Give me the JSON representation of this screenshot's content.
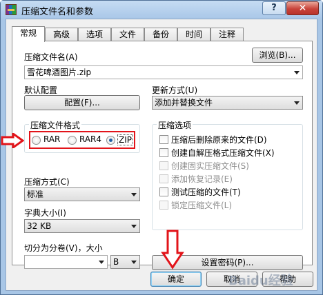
{
  "window": {
    "title": "压缩文件名和参数",
    "help_label": "?",
    "close_label": "✕"
  },
  "tabs": [
    {
      "label": "常规"
    },
    {
      "label": "高级"
    },
    {
      "label": "选项"
    },
    {
      "label": "文件"
    },
    {
      "label": "备份"
    },
    {
      "label": "时间"
    },
    {
      "label": "注释"
    }
  ],
  "general": {
    "archive_name_label": "压缩文件名(A)",
    "browse_label": "浏览(B)...",
    "archive_name_value": "雪花啤酒图片.zip",
    "default_profile_label": "默认配置",
    "profiles_label": "配置(F)...",
    "update_mode_label": "更新方式(U)",
    "update_mode_value": "添加并替换文件",
    "format_group_title": "压缩文件格式",
    "format_rar": "RAR",
    "format_rar4": "RAR4",
    "format_zip": "ZIP",
    "compression_method_label": "压缩方式(C)",
    "compression_method_value": "标准",
    "dictionary_size_label": "字典大小(I)",
    "dictionary_size_value": "32 KB",
    "split_label": "切分为分卷(V)，大小",
    "split_unit_value": "B",
    "set_password_label": "设置密码(P)...",
    "options_group_title": "压缩选项",
    "options": [
      {
        "label": "压缩后删除原来的文件(D)",
        "enabled": true
      },
      {
        "label": "创建自解压格式压缩文件(X)",
        "enabled": true
      },
      {
        "label": "创建固实压缩文件(S)",
        "enabled": false
      },
      {
        "label": "添加恢复记录(E)",
        "enabled": false
      },
      {
        "label": "测试压缩的文件(T)",
        "enabled": true
      },
      {
        "label": "锁定压缩文件(L)",
        "enabled": false
      }
    ]
  },
  "buttons": {
    "ok": "确定",
    "cancel": "取消",
    "help": "帮助"
  },
  "watermark": "Baidu经验",
  "colors": {
    "annotation_red": "#e2141a",
    "title_bar": "#b6d1ee"
  }
}
